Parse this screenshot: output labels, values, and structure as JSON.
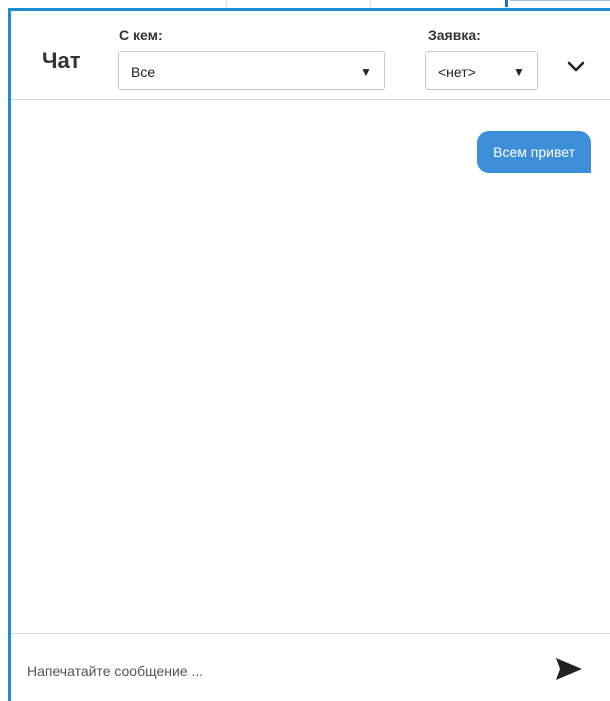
{
  "chat": {
    "title": "Чат",
    "with_label": "С кем:",
    "with_value": "Все",
    "request_label": "Заявка:",
    "request_value": "<нет>",
    "collapse_icon": "chevron-down-icon",
    "select_arrow_icon": "triangle-down-icon"
  },
  "messages": [
    {
      "text": "Всем привет",
      "outgoing": true
    }
  ],
  "composer": {
    "placeholder": "Напечатайте сообщение ...",
    "send_icon": "send-icon"
  },
  "colors": {
    "accent": "#1a8fd1",
    "bubble": "#3d8fd9",
    "bubble_text": "#ffffff"
  }
}
